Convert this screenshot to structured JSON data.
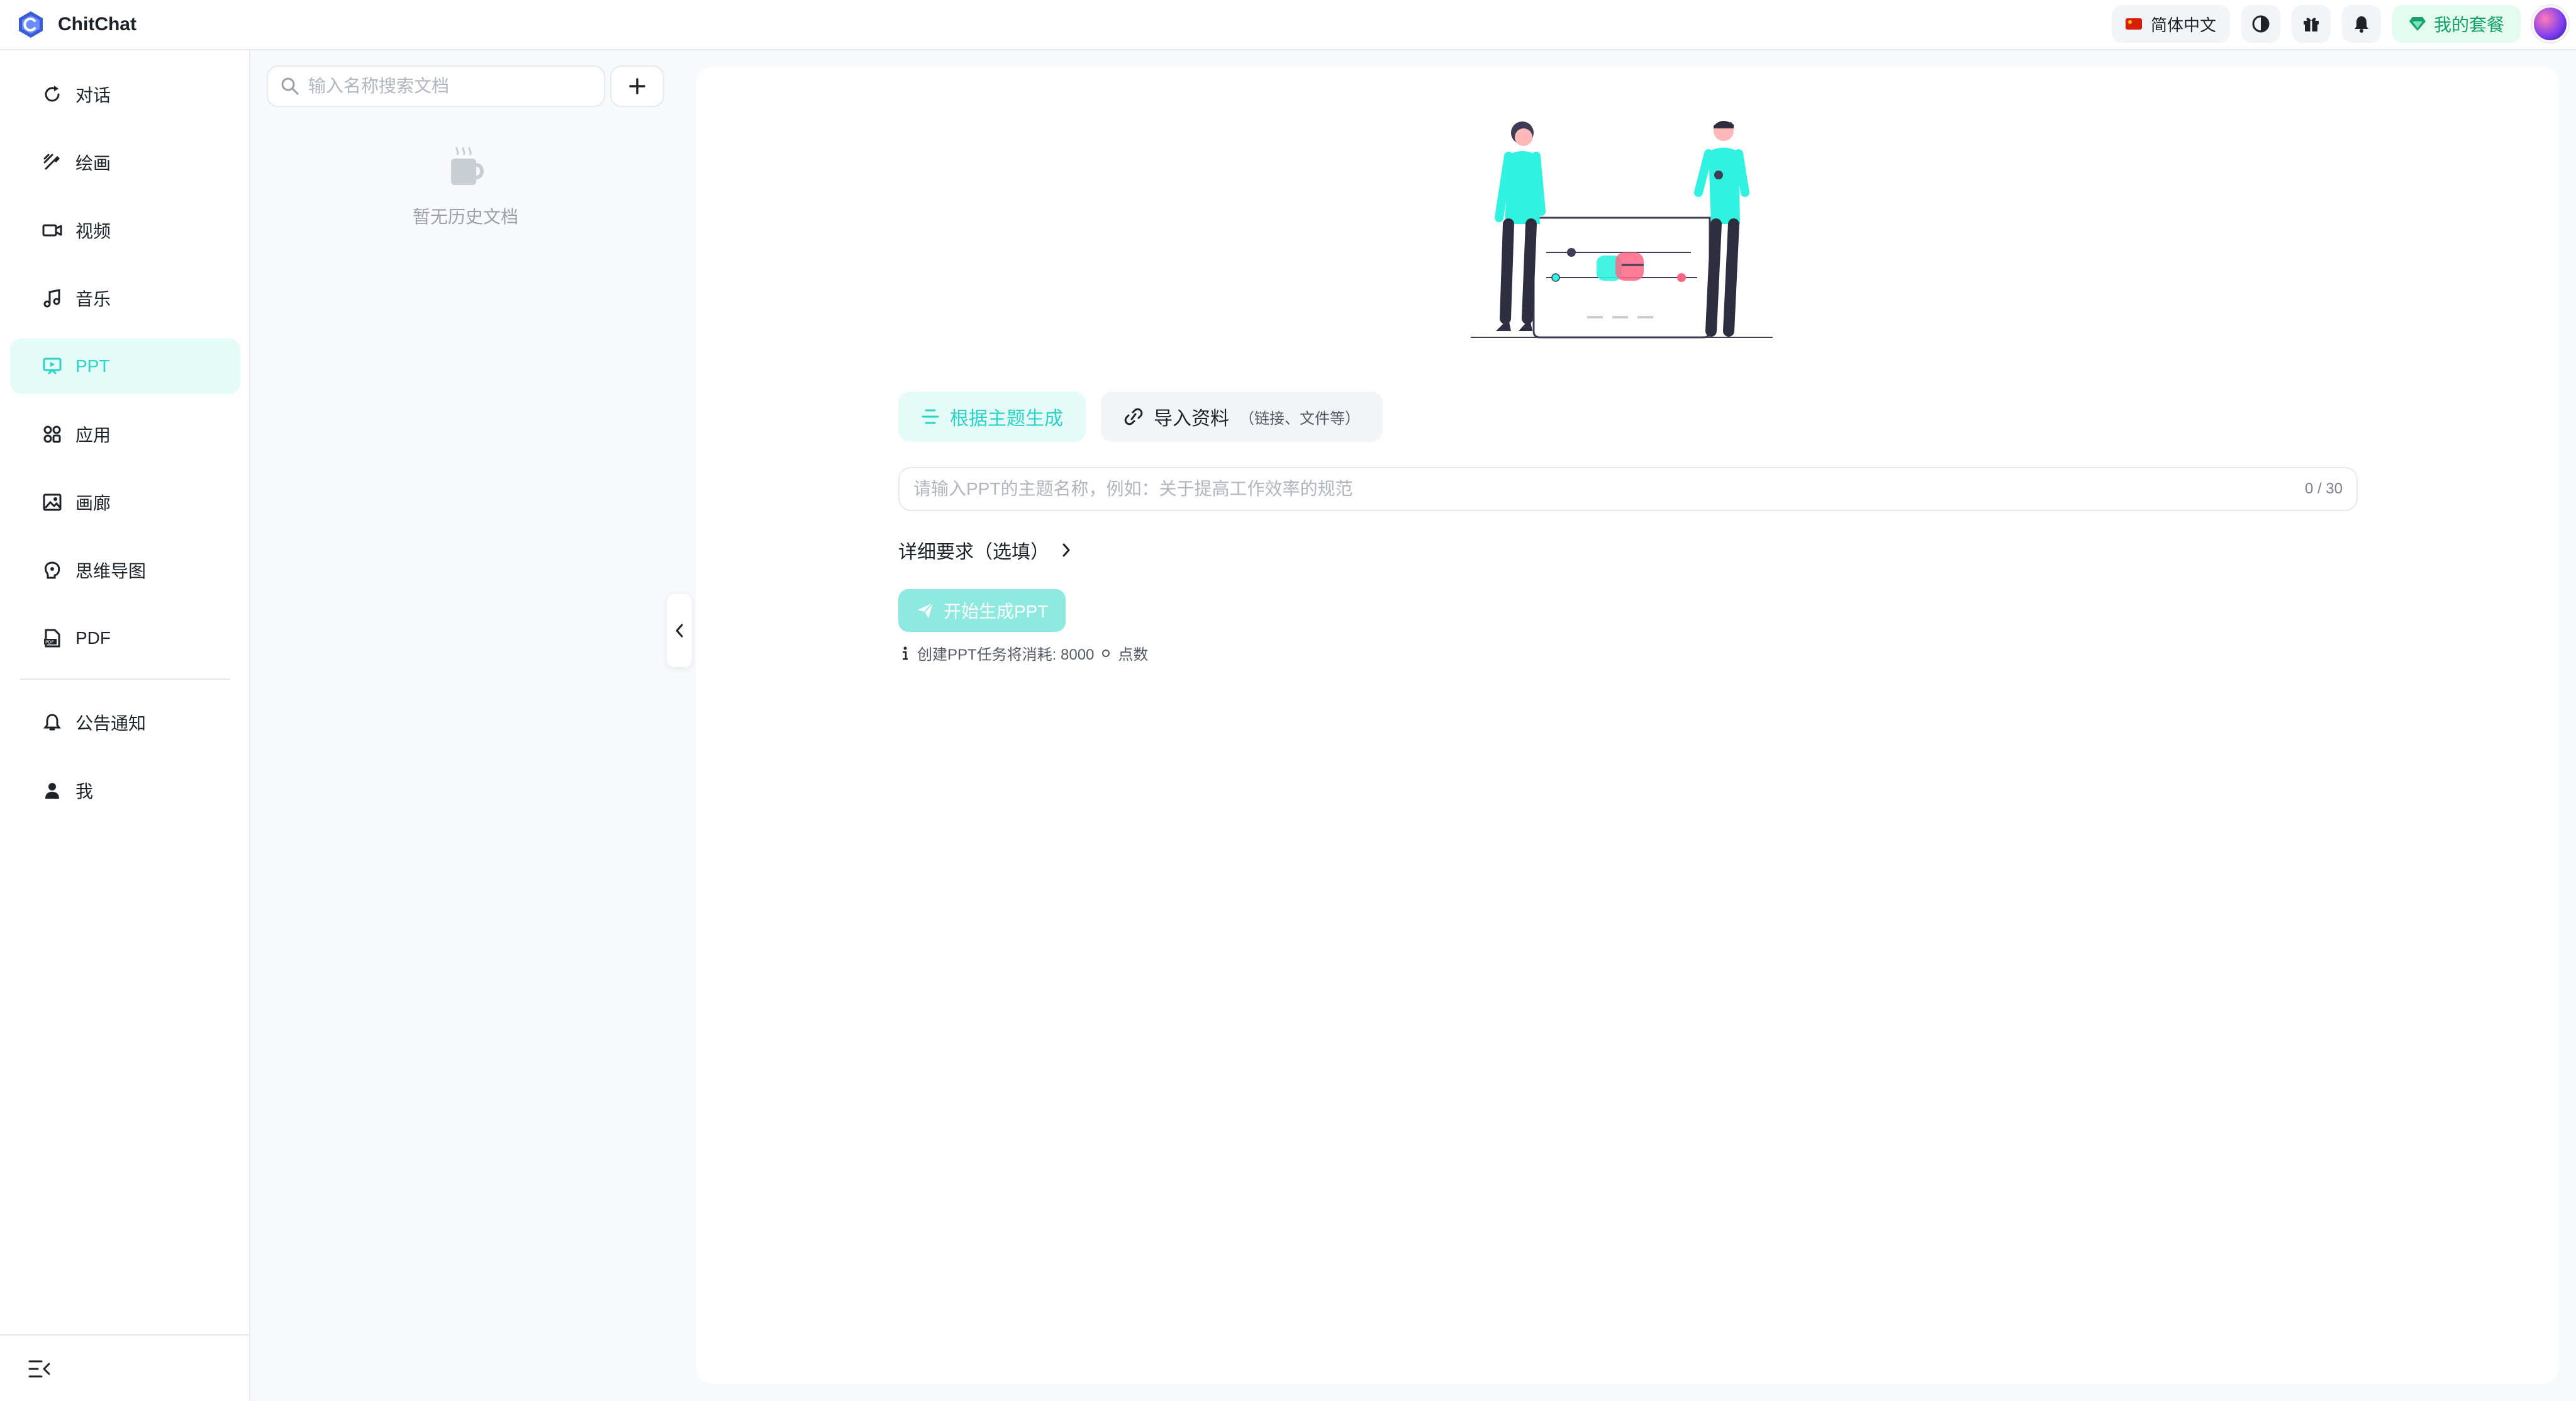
{
  "app": {
    "name": "ChitChat"
  },
  "topbar": {
    "language": "简体中文",
    "plan": "我的套餐",
    "icons": [
      "theme-toggle-icon",
      "gift-icon",
      "bell-icon"
    ]
  },
  "sidebar": {
    "items": [
      {
        "label": "对话",
        "icon": "chat-refresh-icon",
        "active": false
      },
      {
        "label": "绘画",
        "icon": "brush-icon",
        "active": false
      },
      {
        "label": "视频",
        "icon": "video-camera-icon",
        "active": false
      },
      {
        "label": "音乐",
        "icon": "music-note-icon",
        "active": false
      },
      {
        "label": "PPT",
        "icon": "presentation-icon",
        "active": true
      },
      {
        "label": "应用",
        "icon": "apps-icon",
        "active": false
      },
      {
        "label": "画廊",
        "icon": "image-gallery-icon",
        "active": false
      },
      {
        "label": "思维导图",
        "icon": "mind-map-icon",
        "active": false
      },
      {
        "label": "PDF",
        "icon": "pdf-file-icon",
        "active": false
      }
    ],
    "secondary": [
      {
        "label": "公告通知",
        "icon": "bell-icon"
      },
      {
        "label": "我",
        "icon": "user-icon"
      }
    ]
  },
  "history": {
    "search_placeholder": "输入名称搜索文档",
    "empty_text": "暂无历史文档"
  },
  "main": {
    "tabs": [
      {
        "label": "根据主题生成",
        "note": "",
        "active": true
      },
      {
        "label": "导入资料",
        "note": "（链接、文件等）",
        "active": false
      }
    ],
    "topic_placeholder": "请输入PPT的主题名称，例如：关于提高工作效率的规范",
    "counter": "0 / 30",
    "detail_label": "详细要求（选填）",
    "start_label": "开始生成PPT",
    "cost_text": "创建PPT任务将消耗: 8000",
    "cost_unit": "点数"
  },
  "colors": {
    "accent": "#2bd4c6",
    "accent_soft": "#e4fbf8",
    "plan_green": "#14a06a"
  }
}
